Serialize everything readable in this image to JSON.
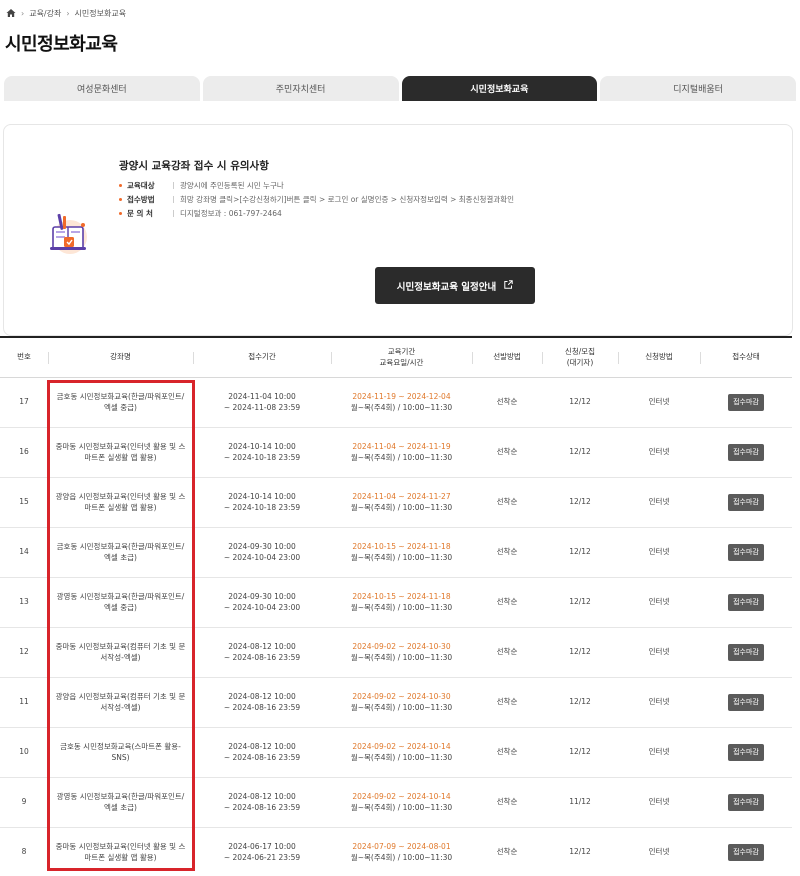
{
  "breadcrumb": {
    "items": [
      "교육/강좌",
      "시민정보화교육"
    ]
  },
  "page_title": "시민정보화교육",
  "tabs": [
    {
      "label": "여성문화센터",
      "active": false
    },
    {
      "label": "주민자치센터",
      "active": false
    },
    {
      "label": "시민정보화교육",
      "active": true
    },
    {
      "label": "디지털배움터",
      "active": false
    }
  ],
  "notice": {
    "title": "광양시 교육강좌 접수 시 유의사항",
    "items": [
      {
        "label": "교육대상",
        "value": "광양시에 주민등록된 시민 누구나"
      },
      {
        "label": "접수방법",
        "value": "희망 강좌명 클릭>[수강신청하기]버튼 클릭 > 로그인 or 실명인증 > 신청자정보입력 > 최종신청결과확인"
      },
      {
        "label": "문 의 처",
        "value": "디지털정보과 : 061-797-2464"
      }
    ],
    "button_label": "시민정보화교육 일정안내"
  },
  "table": {
    "headers": {
      "no": "번호",
      "name": "강좌명",
      "receive": "접수기간",
      "edu_1": "교육기간",
      "edu_2": "교육요일/시간",
      "select": "선발방법",
      "count_1": "신청/모집",
      "count_2": "(대기자)",
      "apply": "신청방법",
      "status": "접수상태"
    },
    "rows": [
      {
        "no": "17",
        "name": "금호동 시민정보화교육(한글/파워포인트/엑셀 중급)",
        "recv_start": "2024-11-04 10:00",
        "recv_end": "~ 2024-11-08 23:59",
        "edu_period": "2024-11-19 ~ 2024-12-04",
        "edu_time": "월~목(주4회) / 10:00~11:30",
        "select": "선착순",
        "count": "12/12",
        "apply": "인터넷",
        "status": "접수마감"
      },
      {
        "no": "16",
        "name": "중마동 시민정보화교육(인터넷 활용 및 스마트폰 실생활 앱 활용)",
        "recv_start": "2024-10-14 10:00",
        "recv_end": "~ 2024-10-18 23:59",
        "edu_period": "2024-11-04 ~ 2024-11-19",
        "edu_time": "월~목(주4회) / 10:00~11:30",
        "select": "선착순",
        "count": "12/12",
        "apply": "인터넷",
        "status": "접수마감"
      },
      {
        "no": "15",
        "name": "광양읍 시민정보화교육(인터넷 활용 및 스마트폰 실생활 앱 활용)",
        "recv_start": "2024-10-14 10:00",
        "recv_end": "~ 2024-10-18 23:59",
        "edu_period": "2024-11-04 ~ 2024-11-27",
        "edu_time": "월~목(주4회) / 10:00~11:30",
        "select": "선착순",
        "count": "12/12",
        "apply": "인터넷",
        "status": "접수마감"
      },
      {
        "no": "14",
        "name": "금호동 시민정보화교육(한글/파워포인트/엑셀 초급)",
        "recv_start": "2024-09-30 10:00",
        "recv_end": "~ 2024-10-04 23:00",
        "edu_period": "2024-10-15 ~ 2024-11-18",
        "edu_time": "월~목(주4회) / 10:00~11:30",
        "select": "선착순",
        "count": "12/12",
        "apply": "인터넷",
        "status": "접수마감"
      },
      {
        "no": "13",
        "name": "광영동 시민정보화교육(한글/파워포인트/엑셀 중급)",
        "recv_start": "2024-09-30 10:00",
        "recv_end": "~ 2024-10-04 23:00",
        "edu_period": "2024-10-15 ~ 2024-11-18",
        "edu_time": "월~목(주4회) / 10:00~11:30",
        "select": "선착순",
        "count": "12/12",
        "apply": "인터넷",
        "status": "접수마감"
      },
      {
        "no": "12",
        "name": "중마동 시민정보화교육(컴퓨터 기초 및 문서작성-엑셀)",
        "recv_start": "2024-08-12 10:00",
        "recv_end": "~ 2024-08-16 23:59",
        "edu_period": "2024-09-02 ~ 2024-10-30",
        "edu_time": "월~목(주4회) / 10:00~11:30",
        "select": "선착순",
        "count": "12/12",
        "apply": "인터넷",
        "status": "접수마감"
      },
      {
        "no": "11",
        "name": "광양읍 시민정보화교육(컴퓨터 기초 및 문서작성-엑셀)",
        "recv_start": "2024-08-12 10:00",
        "recv_end": "~ 2024-08-16 23:59",
        "edu_period": "2024-09-02 ~ 2024-10-30",
        "edu_time": "월~목(주4회) / 10:00~11:30",
        "select": "선착순",
        "count": "12/12",
        "apply": "인터넷",
        "status": "접수마감"
      },
      {
        "no": "10",
        "name": "금호동 시민정보화교육(스마트폰 활용-SNS)",
        "recv_start": "2024-08-12 10:00",
        "recv_end": "~ 2024-08-16 23:59",
        "edu_period": "2024-09-02 ~ 2024-10-14",
        "edu_time": "월~목(주4회) / 10:00~11:30",
        "select": "선착순",
        "count": "12/12",
        "apply": "인터넷",
        "status": "접수마감"
      },
      {
        "no": "9",
        "name": "광영동 시민정보화교육(한글/파워포인트/엑셀 초급)",
        "recv_start": "2024-08-12 10:00",
        "recv_end": "~ 2024-08-16 23:59",
        "edu_period": "2024-09-02 ~ 2024-10-14",
        "edu_time": "월~목(주4회) / 10:00~11:30",
        "select": "선착순",
        "count": "11/12",
        "apply": "인터넷",
        "status": "접수마감"
      },
      {
        "no": "8",
        "name": "중마동 시민정보화교육(인터넷 활용 및 스마트폰 실생활 앱 활용)",
        "recv_start": "2024-06-17 10:00",
        "recv_end": "~ 2024-06-21 23:59",
        "edu_period": "2024-07-09 ~ 2024-08-01",
        "edu_time": "월~목(주4회) / 10:00~11:30",
        "select": "선착순",
        "count": "12/12",
        "apply": "인터넷",
        "status": "접수마감"
      }
    ]
  },
  "colors": {
    "accent": "#e0782a",
    "dark": "#2b2b2b",
    "highlight": "#d8242a"
  }
}
